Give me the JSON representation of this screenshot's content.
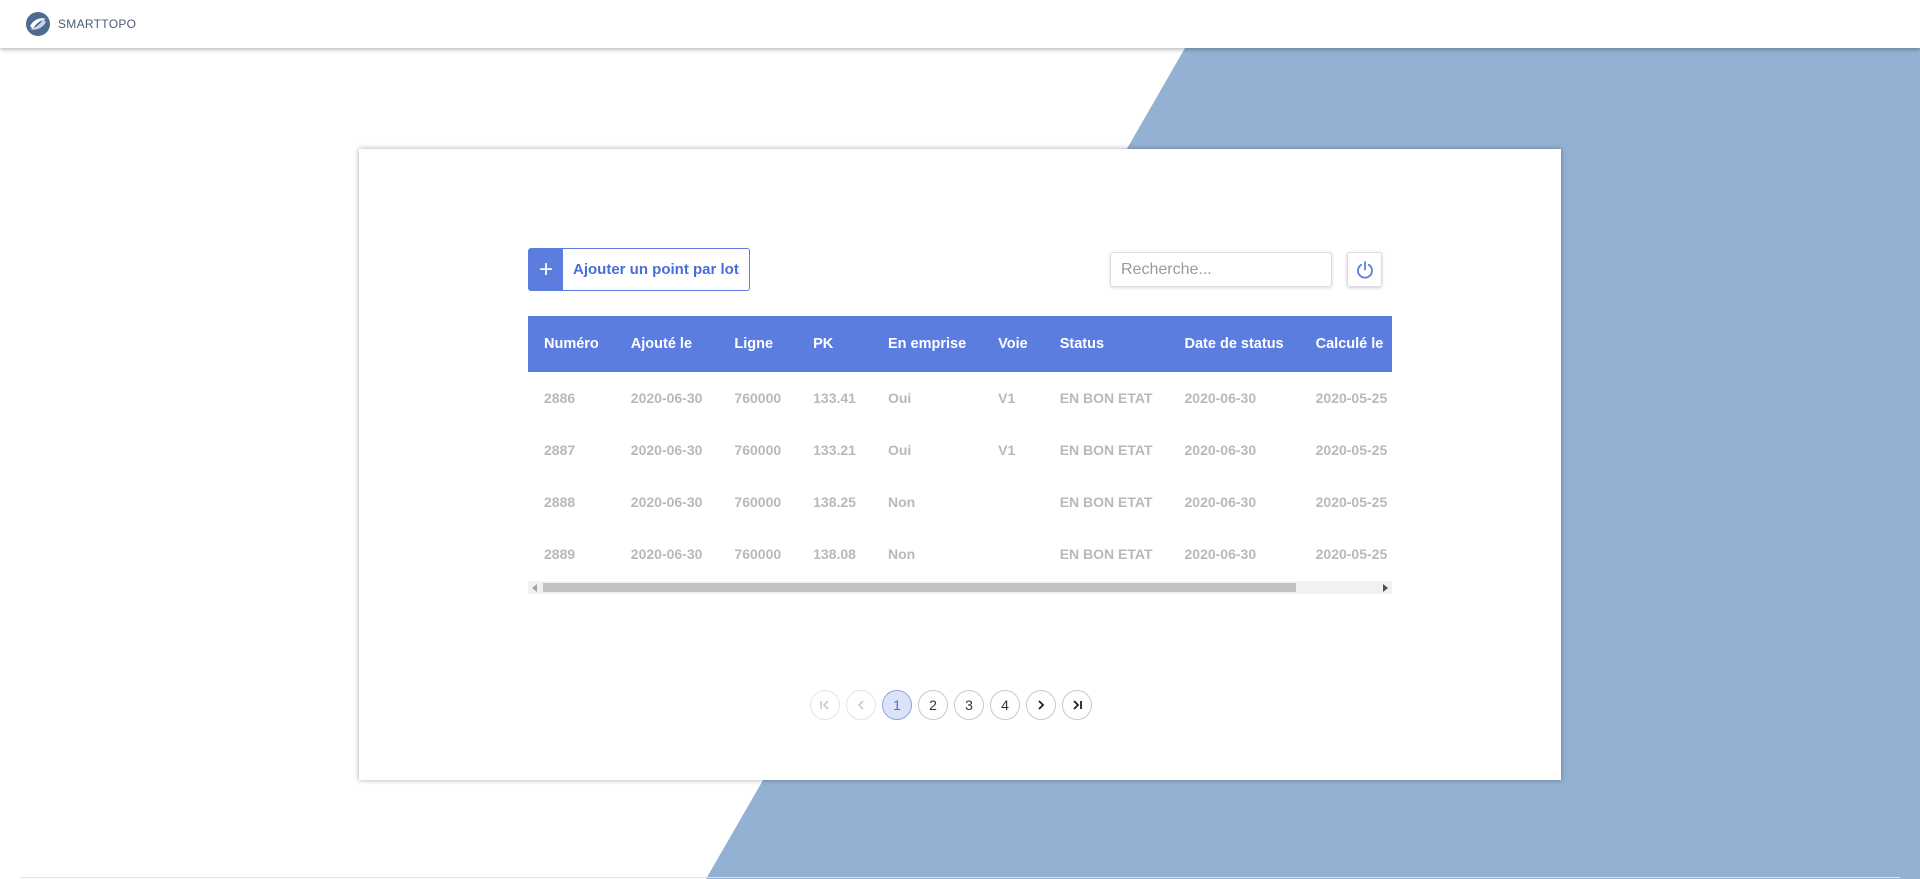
{
  "app": {
    "logo_text": "SMARTTOPO"
  },
  "colors": {
    "accent": "#5b7de0",
    "background_shape": "#93b2d3"
  },
  "toolbar": {
    "add_icon": "+",
    "add_label": "Ajouter un point par lot",
    "search_placeholder": "Recherche...",
    "power_icon": "power-icon"
  },
  "table": {
    "columns": [
      "Numéro",
      "Ajouté le",
      "Ligne",
      "PK",
      "En emprise",
      "Voie",
      "Status",
      "Date de status",
      "Calculé le"
    ],
    "rows": [
      [
        "2886",
        "2020-06-30",
        "760000",
        "133.41",
        "Oui",
        "V1",
        "EN BON ETAT",
        "2020-06-30",
        "2020-05-25"
      ],
      [
        "2887",
        "2020-06-30",
        "760000",
        "133.21",
        "Oui",
        "V1",
        "EN BON ETAT",
        "2020-06-30",
        "2020-05-25"
      ],
      [
        "2888",
        "2020-06-30",
        "760000",
        "138.25",
        "Non",
        "",
        "EN BON ETAT",
        "2020-06-30",
        "2020-05-25"
      ],
      [
        "2889",
        "2020-06-30",
        "760000",
        "138.08",
        "Non",
        "",
        "EN BON ETAT",
        "2020-06-30",
        "2020-05-25"
      ]
    ]
  },
  "pagination": {
    "pages": [
      "1",
      "2",
      "3",
      "4"
    ],
    "current_page": "1",
    "first_icon": "first-page-icon",
    "prev_icon": "previous-page-icon",
    "next_icon": "next-page-icon",
    "last_icon": "last-page-icon"
  }
}
